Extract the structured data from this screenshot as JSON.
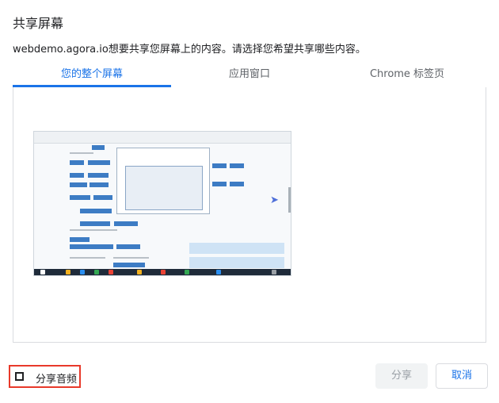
{
  "dialog": {
    "title": "共享屏幕",
    "description": "webdemo.agora.io想要共享您屏幕上的内容。请选择您希望共享哪些内容。"
  },
  "tabs": [
    {
      "label": "您的整个屏幕",
      "active": true
    },
    {
      "label": "应用窗口",
      "active": false
    },
    {
      "label": "Chrome 标签页",
      "active": false
    }
  ],
  "preview": {
    "icon": "screen-thumbnail"
  },
  "audio": {
    "label": "分享音频",
    "checked": false
  },
  "buttons": {
    "share": "分享",
    "cancel": "取消"
  },
  "colors": {
    "accent": "#1a73e8",
    "highlight_border": "#e8392a",
    "disabled_bg": "#f1f3f4"
  }
}
